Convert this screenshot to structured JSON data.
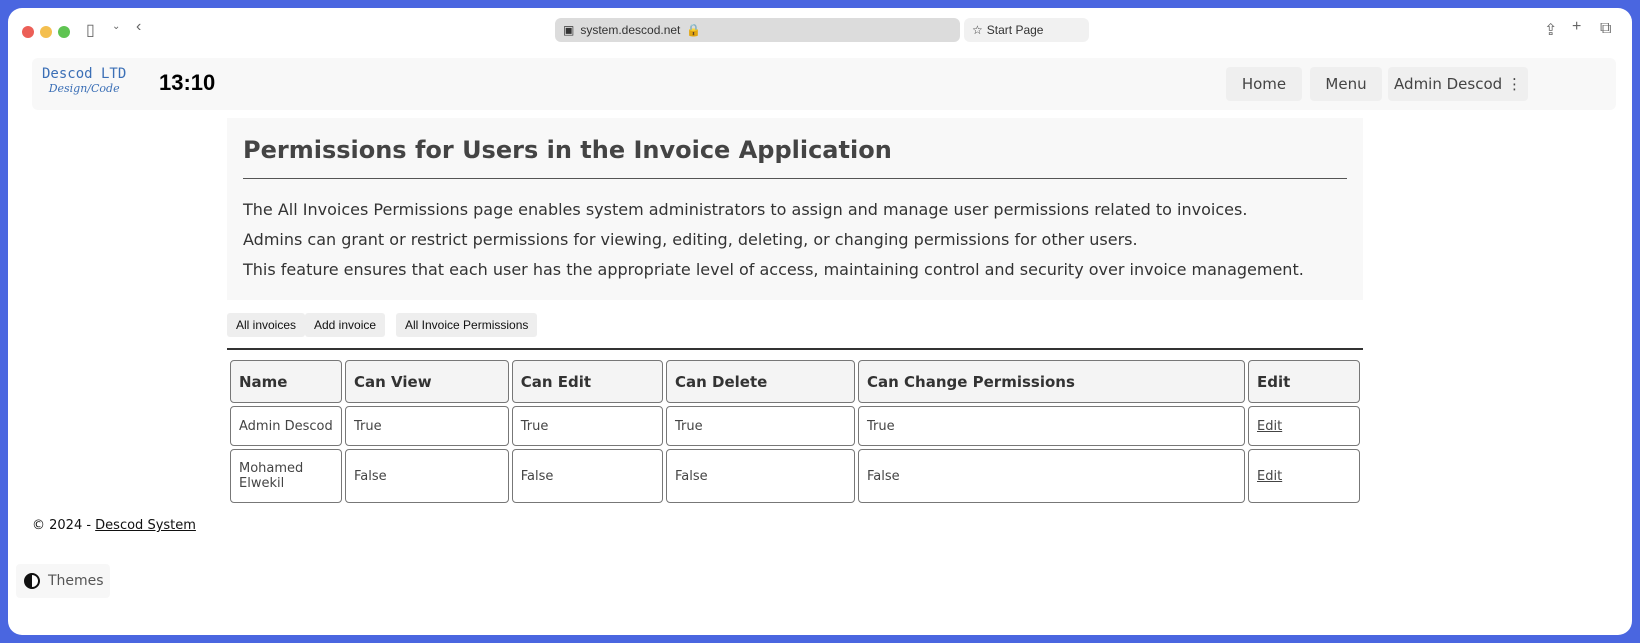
{
  "browser": {
    "url": "system.descod.net",
    "start_page": "Start Page"
  },
  "nav": {
    "logo_line1": "Descod LTD",
    "logo_line2": "Design/Code",
    "clock": "13:10",
    "home": "Home",
    "menu": "Menu",
    "user": "Admin Descod",
    "more": "⋮"
  },
  "intro": {
    "title": "Permissions for Users in the Invoice Application",
    "lines": [
      "The All Invoices Permissions page enables system administrators to assign and manage user permissions related to invoices.",
      "Admins can grant or restrict permissions for viewing, editing, deleting, or changing permissions for other users.",
      "This feature ensures that each user has the appropriate level of access, maintaining control and security over invoice management."
    ]
  },
  "subnav": [
    "All invoices",
    "Add invoice",
    "All Invoice Permissions"
  ],
  "table": {
    "headers": [
      "Name",
      "Can View",
      "Can Edit",
      "Can Delete",
      "Can Change Permissions",
      "Edit"
    ],
    "rows": [
      [
        "Admin Descod",
        "True",
        "True",
        "True",
        "True",
        "Edit"
      ],
      [
        "Mohamed Elwekil",
        "False",
        "False",
        "False",
        "False",
        "Edit"
      ]
    ]
  },
  "footer": {
    "prefix": "© 2024 - ",
    "link": "Descod System"
  },
  "themes": "Themes"
}
